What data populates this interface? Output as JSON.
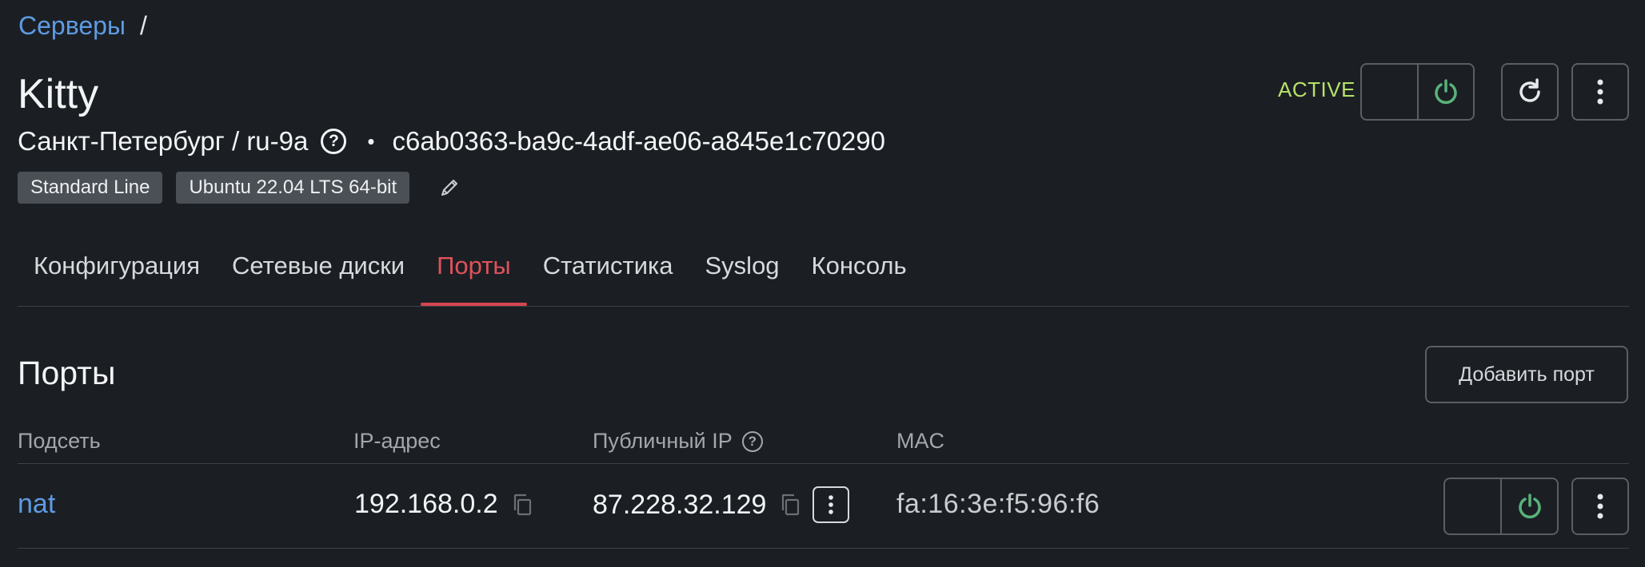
{
  "breadcrumb": {
    "link": "Серверы",
    "separator": "/"
  },
  "server": {
    "name": "Kitty",
    "location": "Санкт-Петербург / ru-9a",
    "bullet": "•",
    "id": "c6ab0363-ba9c-4adf-ae06-a845e1c70290",
    "tags": [
      "Standard Line",
      "Ubuntu 22.04 LTS 64-bit"
    ],
    "status": "ACTIVE"
  },
  "colors": {
    "accent_link": "#5e9be2",
    "status_active": "#b7e26a",
    "tab_active": "#e0525a",
    "power_green": "#59b27a"
  },
  "icons": [
    "help-icon",
    "pencil-icon",
    "power-icon",
    "refresh-icon",
    "kebab-icon",
    "copy-icon"
  ],
  "tabs": [
    {
      "label": "Конфигурация",
      "active": false
    },
    {
      "label": "Сетевые диски",
      "active": false
    },
    {
      "label": "Порты",
      "active": true
    },
    {
      "label": "Статистика",
      "active": false
    },
    {
      "label": "Syslog",
      "active": false
    },
    {
      "label": "Консоль",
      "active": false
    }
  ],
  "ports": {
    "title": "Порты",
    "add_button": "Добавить порт",
    "columns": [
      "Подсеть",
      "IP-адрес",
      "Публичный IP",
      "MAC"
    ],
    "rows": [
      {
        "subnet": "nat",
        "ip": "192.168.0.2",
        "public_ip": "87.228.32.129",
        "mac": "fa:16:3e:f5:96:f6"
      }
    ]
  }
}
